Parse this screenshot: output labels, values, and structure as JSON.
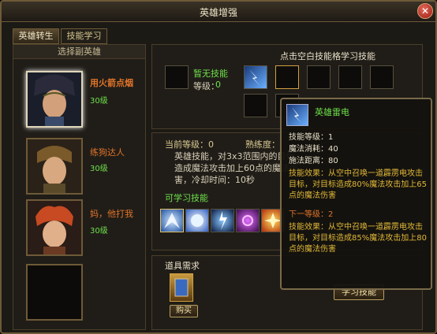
{
  "window": {
    "title": "英雄增强"
  },
  "tabs": [
    {
      "label": "英雄转生",
      "active": true
    },
    {
      "label": "技能学习",
      "active": false
    }
  ],
  "left_panel": {
    "header": "选择副英雄",
    "heroes": [
      {
        "name": "用火箭点烟",
        "level": "30级",
        "name_color": "#e0742a",
        "selected": true
      },
      {
        "name": "练狗达人",
        "level": "30级",
        "name_color": "#e0742a",
        "selected": false
      },
      {
        "name": "妈，他打我",
        "level": "30级",
        "name_color": "#e0742a",
        "selected": false
      }
    ]
  },
  "skill_grid": {
    "header": "点击空白技能格学习技能",
    "current_skill_name": "暂无技能",
    "level_label": "等级：",
    "level_value": "0"
  },
  "skill_info": {
    "current_level": "当前等级：0",
    "proficiency": "熟练度：",
    "description": "英雄技能，对3x3范围内的目标造成魔法攻击加上60点的魔法伤害，冷却时间：10秒"
  },
  "learnable": {
    "header": "可学习技能",
    "icons": [
      "ice-shard",
      "frost-orb",
      "lightning",
      "arcane",
      "fire-burst",
      "lava-golem",
      "rage"
    ]
  },
  "items": {
    "header": "道具需求",
    "buy_label": "购买"
  },
  "learn_button": "学习技能",
  "tooltip": {
    "name": "英雄雷电",
    "level": "技能等级：1",
    "mana": "魔法消耗：40",
    "range": "施法距离：80",
    "effect": "技能效果：从空中召唤一道霹雳电攻击目标，对目标造成80%魔法攻击加上65点的魔法伤害",
    "next_level": "下一等级：2",
    "next_effect": "技能效果：从空中召唤一道霹雳电攻击目标，对目标造成85%魔法攻击加上80点的魔法伤害"
  },
  "colors": {
    "accent_green": "#6ee04a",
    "title_gold": "#f0e6c8",
    "orange": "#e0742a"
  }
}
